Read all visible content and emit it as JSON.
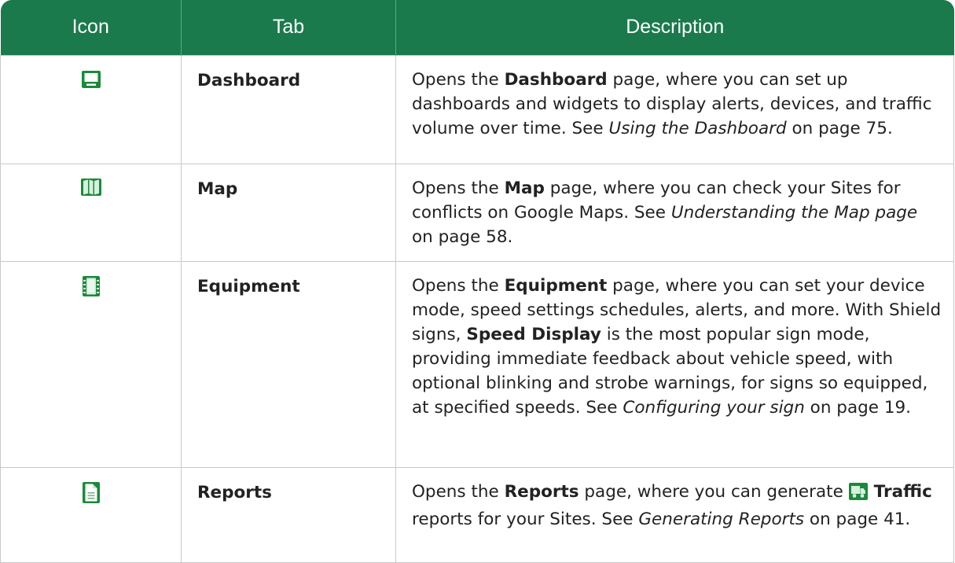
{
  "header": {
    "col_icon": "Icon",
    "col_tab": "Tab",
    "col_description": "Description"
  },
  "rows": [
    {
      "icon": "dashboard-monitor-icon",
      "tab": "Dashboard",
      "desc": {
        "pre": "Opens the ",
        "bold": "Dashboard",
        "mid": " page, where you can set up dashboards and widgets to display alerts, devices, and traffic volume over time. See ",
        "italic": "Using the Dashboard",
        "post": " on page 75."
      }
    },
    {
      "icon": "map-icon",
      "tab": "Map",
      "desc": {
        "pre": "Opens the ",
        "bold": "Map",
        "mid": " page, where you can check your Sites for conflicts on Google Maps. See ",
        "italic": "Understanding the Map page",
        "post": " on page 58."
      }
    },
    {
      "icon": "equipment-chip-icon",
      "tab": "Equipment",
      "desc": {
        "pre": "Opens the ",
        "bold": "Equipment",
        "mid": " page, where you can set your device mode, speed settings schedules, alerts, and more. With Shield signs, ",
        "bold2": "Speed Display",
        "mid2": " is the most popular sign mode, providing immediate feedback about vehicle speed, with optional blinking and strobe warnings, for signs so equipped, at specified speeds. See ",
        "italic": "Configuring your sign",
        "post": " on page 19."
      }
    },
    {
      "icon": "reports-document-icon",
      "tab": "Reports",
      "desc": {
        "pre": "Opens the ",
        "bold": "Reports",
        "mid": " page, where you can generate ",
        "inline_icon": "traffic-truck-icon",
        "bold2": "Traffic",
        "mid2": " reports for your Sites. See ",
        "italic": "Generating Reports",
        "post": " on page 41."
      }
    }
  ],
  "colors": {
    "header_bg": "#1a7a4c",
    "header_text": "#ffffff",
    "border": "#c9c9c9",
    "icon_green": "#1a8a3a"
  }
}
